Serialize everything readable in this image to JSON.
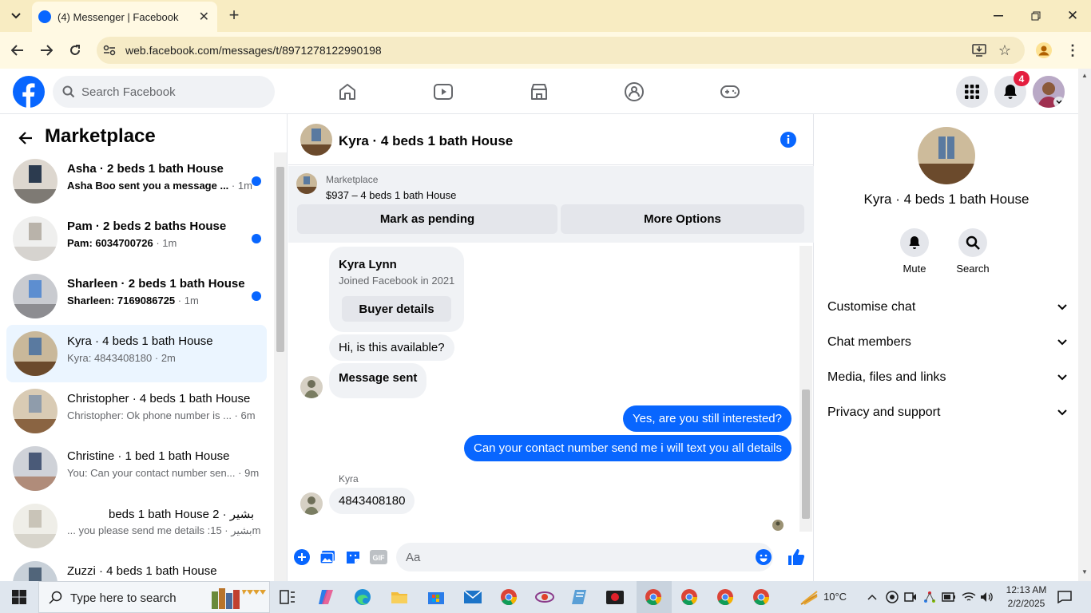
{
  "browser": {
    "tab_title": "(4) Messenger | Facebook",
    "url": "web.facebook.com/messages/t/8971278122990198"
  },
  "fbnav": {
    "search_placeholder": "Search Facebook",
    "notifications_count": "4"
  },
  "left": {
    "title": "Marketplace",
    "conversations": [
      {
        "title": "Asha · 2 beds 1 bath House",
        "preview": "Asha Boo sent you a message ...",
        "time": " · 1m",
        "unread": true
      },
      {
        "title": "Pam · 2 beds 2 baths House",
        "preview": "Pam: 6034700726",
        "time": " · 1m",
        "unread": true
      },
      {
        "title": "Sharleen · 2 beds 1 bath House",
        "preview": "Sharleen: 7169086725",
        "time": " · 1m",
        "unread": true
      },
      {
        "title": "Kyra · 4 beds 1 bath House",
        "preview": "Kyra: 4843408180",
        "time": " · 2m",
        "unread": false,
        "selected": true
      },
      {
        "title": "Christopher · 4 beds 1 bath House",
        "preview": "Christopher: Ok phone number is ...",
        "time": " · 6m",
        "unread": false
      },
      {
        "title": "Christine · 1 bed 1 bath House",
        "preview": "You: Can your contact number sen...",
        "time": " · 9m",
        "unread": false
      },
      {
        "title": "beds 1 bath House 2 · بشير",
        "preview": "... you please send me details :بشير",
        "time": " · 15m",
        "unread": false
      },
      {
        "title": "Zuzzi · 4 beds 1 bath House",
        "preview": "",
        "time": "",
        "unread": false
      }
    ]
  },
  "chat": {
    "title": "Kyra · 4 beds 1 bath House",
    "marketplace_label": "Marketplace",
    "listing": "$937 – 4 beds 1 bath House",
    "mark_pending": "Mark as pending",
    "more_options": "More Options",
    "buyer_name": "Kyra Lynn",
    "buyer_joined": "Joined Facebook in 2021",
    "buyer_details": "Buyer details",
    "msg1": "Hi, is this available?",
    "msg2": "Message sent",
    "msg3": "Yes, are you still interested?",
    "msg4": "Can your contact number send me i will text you all details",
    "sender_label": "Kyra",
    "msg5": "4843408180",
    "composer_placeholder": "Aa"
  },
  "right": {
    "name": "Kyra · 4 beds 1 bath House",
    "mute": "Mute",
    "search": "Search",
    "sections": [
      "Customise chat",
      "Chat members",
      "Media, files and links",
      "Privacy and support"
    ]
  },
  "taskbar": {
    "search_placeholder": "Type here to search",
    "weather": "10°C",
    "time": "12:13 AM",
    "date": "2/2/2025"
  },
  "colors": {
    "fb_blue": "#0866ff",
    "selected_bg": "#ebf5ff",
    "chrome_tab": "#f8ecc2"
  }
}
